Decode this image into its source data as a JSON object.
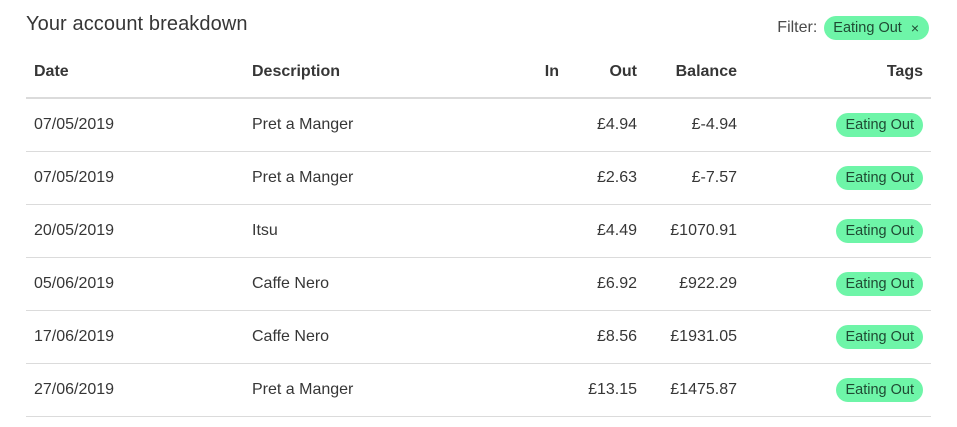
{
  "header": {
    "title": "Your account breakdown",
    "filter_label": "Filter:",
    "filter_tag": "Eating Out",
    "filter_remove": "×"
  },
  "table": {
    "columns": {
      "date": "Date",
      "description": "Description",
      "in": "In",
      "out": "Out",
      "balance": "Balance",
      "tags": "Tags"
    },
    "rows": [
      {
        "date": "07/05/2019",
        "description": "Pret a Manger",
        "in": "",
        "out": "£4.94",
        "balance": "£-4.94",
        "tag": "Eating Out"
      },
      {
        "date": "07/05/2019",
        "description": "Pret a Manger",
        "in": "",
        "out": "£2.63",
        "balance": "£-7.57",
        "tag": "Eating Out"
      },
      {
        "date": "20/05/2019",
        "description": "Itsu",
        "in": "",
        "out": "£4.49",
        "balance": "£1070.91",
        "tag": "Eating Out"
      },
      {
        "date": "05/06/2019",
        "description": "Caffe Nero",
        "in": "",
        "out": "£6.92",
        "balance": "£922.29",
        "tag": "Eating Out"
      },
      {
        "date": "17/06/2019",
        "description": "Caffe Nero",
        "in": "",
        "out": "£8.56",
        "balance": "£1931.05",
        "tag": "Eating Out"
      },
      {
        "date": "27/06/2019",
        "description": "Pret a Manger",
        "in": "",
        "out": "£13.15",
        "balance": "£1475.87",
        "tag": "Eating Out"
      }
    ]
  },
  "colors": {
    "tag_background": "#6ef5a8",
    "tag_text": "#1f4a33",
    "text": "#363636",
    "divider": "#dbdbdb"
  }
}
